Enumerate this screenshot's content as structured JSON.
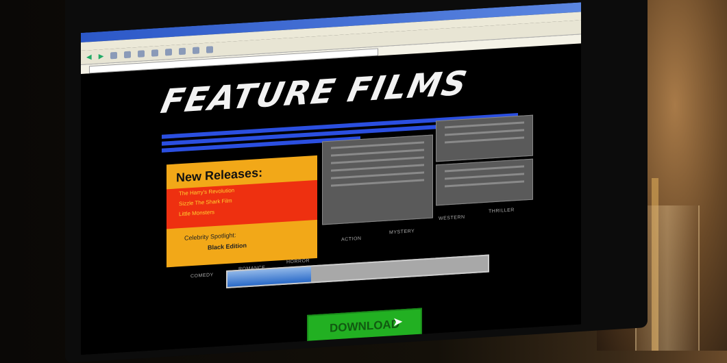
{
  "site": {
    "logo_text": "FEATURE FILMS",
    "new_releases": {
      "heading": "New Releases:",
      "items": [
        "The Harry's Revolution",
        "Sizzle The Shark Film",
        "Little Monsters"
      ]
    },
    "spotlight": {
      "label": "Celebrity Spotlight:",
      "title": "Black Edition"
    },
    "nav_left": [
      "COMEDY",
      "ROMANCE",
      "HORROR",
      "ACTION",
      "MYSTERY"
    ],
    "nav_right": [
      "WESTERN",
      "THRILLER"
    ],
    "download_label": "DOWNLOAD",
    "download_progress": 0.32
  },
  "colors": {
    "accent_blue": "#2b4fe0",
    "releases_orange": "#f2a818",
    "releases_red": "#ee3010",
    "download_green": "#22b022"
  }
}
